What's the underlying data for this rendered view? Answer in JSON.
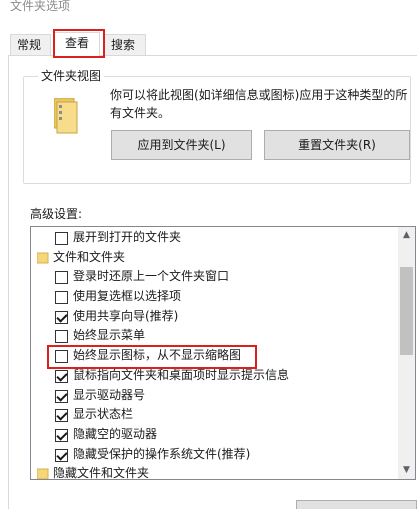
{
  "window": {
    "title": "文件夹选项"
  },
  "tabs": [
    {
      "label": "常规"
    },
    {
      "label": "查看",
      "selected": true
    },
    {
      "label": "搜索"
    }
  ],
  "folder_views": {
    "group_label": "文件夹视图",
    "description": "你可以将此视图(如详细信息或图标)应用于这种类型的所有文件夹。",
    "apply_button": "应用到文件夹(L)",
    "reset_button": "重置文件夹(R)",
    "icon": "folder-icon"
  },
  "advanced": {
    "label": "高级设置:",
    "items": [
      {
        "type": "checkbox",
        "label": "展开到打开的文件夹",
        "checked": false
      },
      {
        "type": "folder",
        "label": "文件和文件夹"
      },
      {
        "type": "checkbox",
        "label": "登录时还原上一个文件夹窗口",
        "checked": false
      },
      {
        "type": "checkbox",
        "label": "使用复选框以选择项",
        "checked": false
      },
      {
        "type": "checkbox",
        "label": "使用共享向导(推荐)",
        "checked": true
      },
      {
        "type": "checkbox",
        "label": "始终显示菜单",
        "checked": false
      },
      {
        "type": "checkbox",
        "label": "始终显示图标，从不显示缩略图",
        "checked": false,
        "highlighted": true
      },
      {
        "type": "checkbox",
        "label": "鼠标指向文件夹和桌面项时显示提示信息",
        "checked": true
      },
      {
        "type": "checkbox",
        "label": "显示驱动器号",
        "checked": true
      },
      {
        "type": "checkbox",
        "label": "显示状态栏",
        "checked": true
      },
      {
        "type": "checkbox",
        "label": "隐藏空的驱动器",
        "checked": true
      },
      {
        "type": "checkbox",
        "label": "隐藏受保护的操作系统文件(推荐)",
        "checked": true
      },
      {
        "type": "folder",
        "label": "隐藏文件和文件夹"
      }
    ]
  },
  "colors": {
    "highlight": "#d9211e",
    "folder": "#f5d77a",
    "button_bg": "#e1e1e1"
  }
}
